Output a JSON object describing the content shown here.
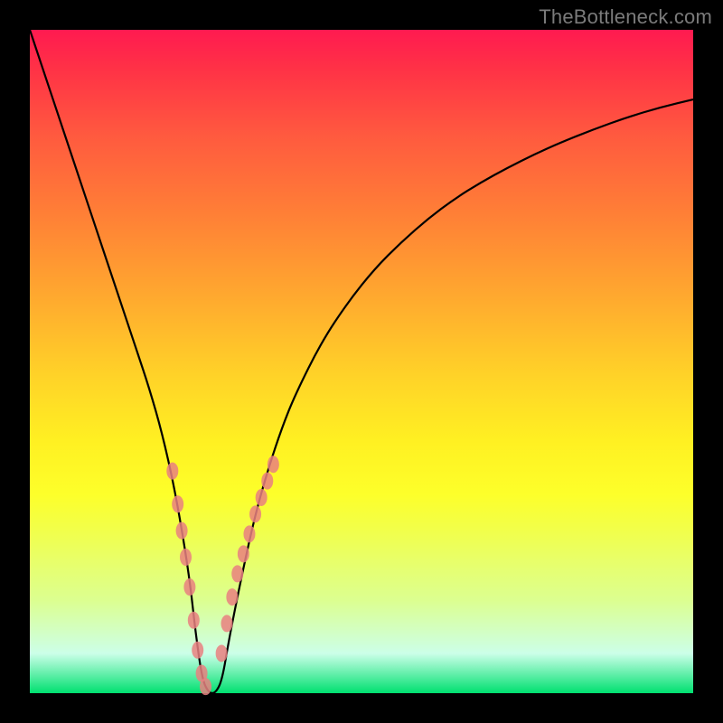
{
  "watermark": "TheBottleneck.com",
  "colors": {
    "background": "#000000",
    "gradient_top": "#ff1a50",
    "gradient_bottom": "#00e070",
    "curve": "#000000",
    "marker": "#e98080"
  },
  "chart_data": {
    "type": "line",
    "title": "",
    "xlabel": "",
    "ylabel": "",
    "xlim": [
      0,
      100
    ],
    "ylim": [
      0,
      100
    ],
    "x": [
      0,
      2,
      4,
      6,
      8,
      10,
      12,
      14,
      16,
      18,
      20,
      22,
      24,
      25,
      26,
      27,
      28,
      29,
      30,
      32,
      34,
      36,
      38,
      40,
      44,
      48,
      52,
      56,
      60,
      64,
      68,
      72,
      76,
      80,
      85,
      90,
      95,
      100
    ],
    "y": [
      100,
      94,
      88,
      82,
      76,
      70,
      64,
      58,
      52,
      46,
      39,
      30,
      18,
      9,
      2,
      0,
      0,
      2,
      8,
      18,
      27,
      34,
      40,
      45,
      53,
      59,
      64,
      68,
      71.5,
      74.5,
      77,
      79.2,
      81.2,
      83,
      85,
      86.8,
      88.3,
      89.5
    ],
    "marker_points_left": {
      "x": [
        21.5,
        22.3,
        22.9,
        23.5,
        24.1,
        24.7,
        25.3,
        25.9,
        26.5
      ],
      "y": [
        33.5,
        28.5,
        24.5,
        20.5,
        16.0,
        11.0,
        6.5,
        3.0,
        1.0
      ]
    },
    "marker_points_right": {
      "x": [
        28.9,
        29.7,
        30.5,
        31.3,
        32.2,
        33.1,
        34.0,
        34.9,
        35.8,
        36.7
      ],
      "y": [
        6.0,
        10.5,
        14.5,
        18.0,
        21.0,
        24.0,
        27.0,
        29.5,
        32.0,
        34.5
      ]
    }
  }
}
